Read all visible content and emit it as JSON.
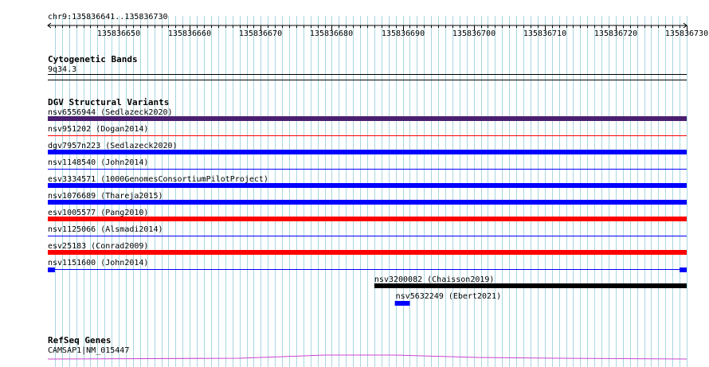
{
  "ruler": {
    "location_label": "chr9:135836641..135836730",
    "start": 135836641,
    "end": 135836730,
    "tick_labels": [
      "135836650",
      "135836660",
      "135836670",
      "135836680",
      "135836690",
      "135836700",
      "135836710",
      "135836720",
      "135836730"
    ]
  },
  "tracks": {
    "cytoband": {
      "title": "Cytogenetic Bands",
      "band_label": "9q34.3"
    },
    "dgv": {
      "title": "DGV Structural Variants",
      "features": [
        {
          "label": "nsv6556944 (Sedlazeck2020)",
          "color": "#4b1f6f",
          "shape": "bar",
          "start": 135836641,
          "end": 135836730
        },
        {
          "label": "nsv951202 (Dogan2014)",
          "color": "#ff0000",
          "shape": "line",
          "start": 135836641,
          "end": 135836730
        },
        {
          "label": "dgv7957n223 (Sedlazeck2020)",
          "color": "#0000ff",
          "shape": "bar",
          "start": 135836641,
          "end": 135836730
        },
        {
          "label": "nsv1148540 (John2014)",
          "color": "#0000ff",
          "shape": "line",
          "start": 135836641,
          "end": 135836730
        },
        {
          "label": "esv3334571 (1000GenomesConsortiumPilotProject)",
          "color": "#0000ff",
          "shape": "bar",
          "start": 135836641,
          "end": 135836730
        },
        {
          "label": "nsv1076689 (Thareja2015)",
          "color": "#0000ff",
          "shape": "bar",
          "start": 135836641,
          "end": 135836730
        },
        {
          "label": "esv1005577 (Pang2010)",
          "color": "#ff0000",
          "shape": "bar",
          "start": 135836641,
          "end": 135836730
        },
        {
          "label": "nsv1125066 (Alsmadi2014)",
          "color": "#0000ff",
          "shape": "line",
          "start": 135836641,
          "end": 135836730
        },
        {
          "label": "esv25183 (Conrad2009)",
          "color": "#ff0000",
          "shape": "bar",
          "start": 135836641,
          "end": 135836730
        },
        {
          "label": "nsv1151600 (John2014)",
          "color": "#0000ff",
          "shape": "line-end-blocks",
          "start": 135836641,
          "end": 135836730
        },
        {
          "label": "nsv3200082 (Chaisson2019)",
          "color": "#000000",
          "shape": "bar",
          "start": 135836687,
          "end": 135836730
        },
        {
          "label": "nsv5632249 (Ebert2021)",
          "color": "#0000ff",
          "shape": "block",
          "start": 135836690,
          "end": 135836691
        }
      ]
    },
    "refseq": {
      "title": "RefSeq Genes",
      "gene_label": "CAMSAP1|NM_015447",
      "color": "#cc44cc"
    }
  },
  "colors": {
    "grid_line": "#a8d6e0",
    "ruler": "#000000"
  }
}
